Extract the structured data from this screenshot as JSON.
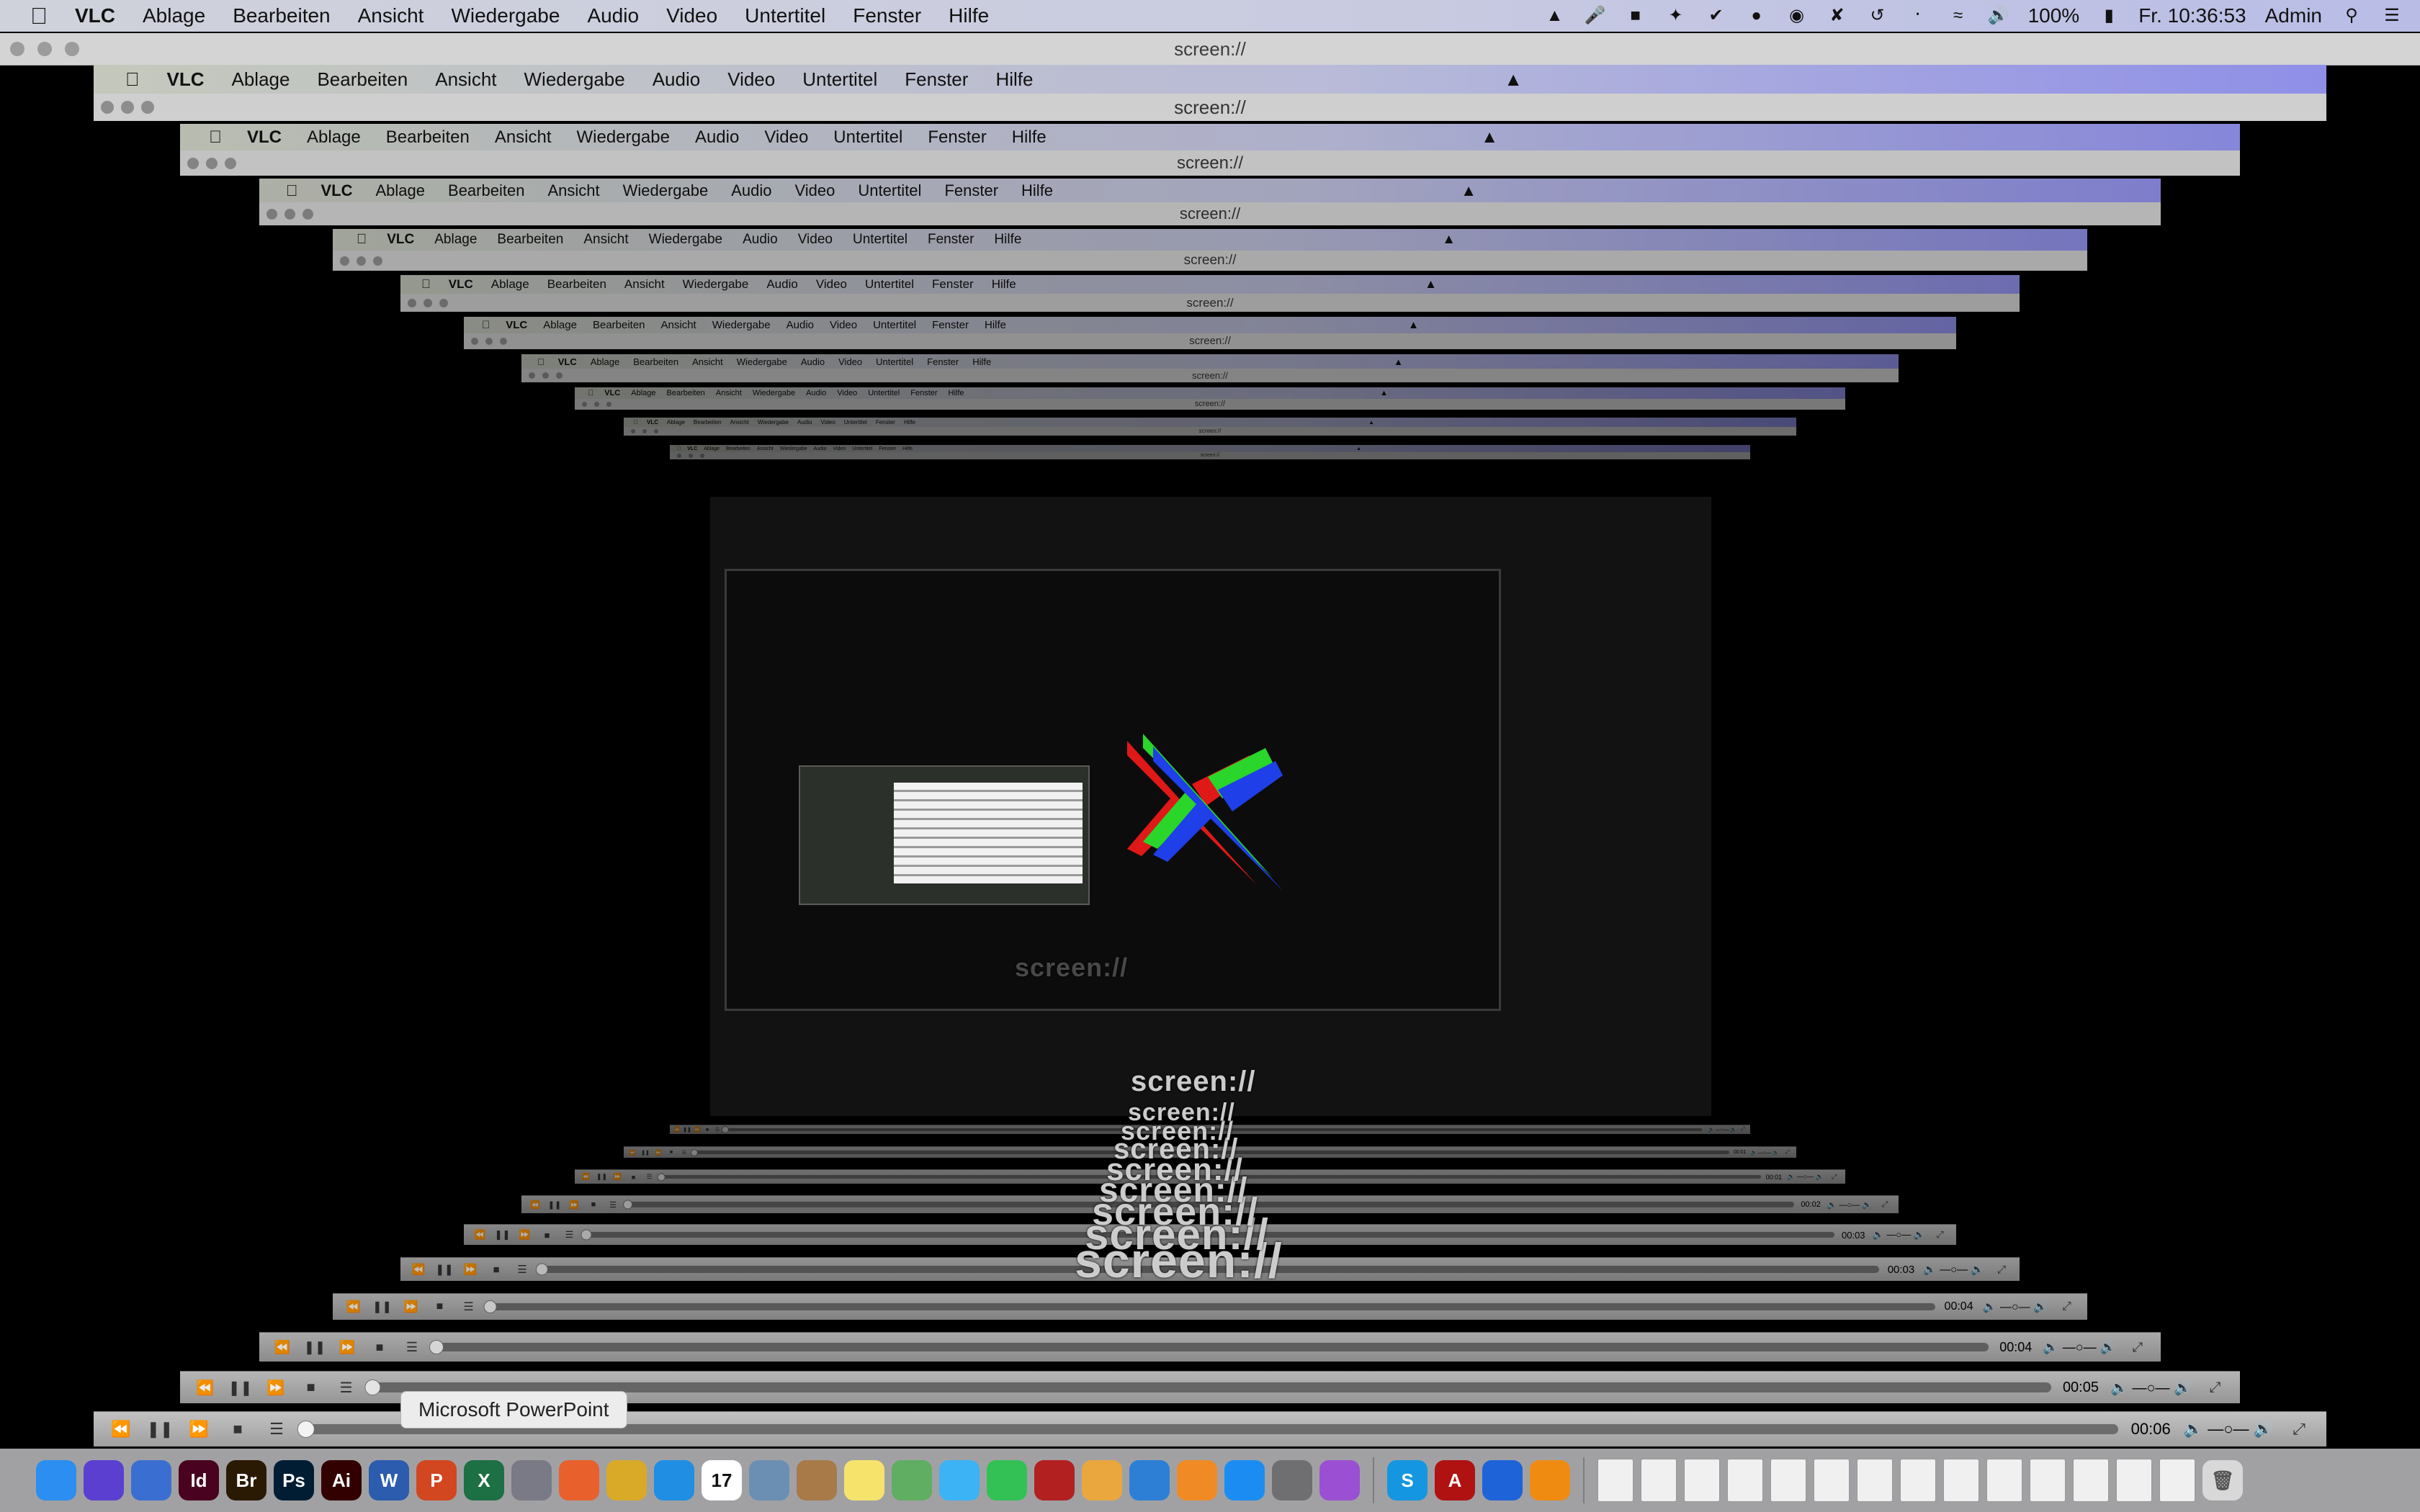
{
  "menubar": {
    "app": "VLC",
    "items": [
      "Ablage",
      "Bearbeiten",
      "Ansicht",
      "Wiedergabe",
      "Audio",
      "Video",
      "Untertitel",
      "Fenster",
      "Hilfe"
    ],
    "battery": "100%",
    "clock": "Fr. 10:36:53",
    "user": "Admin"
  },
  "window": {
    "title": "screen://"
  },
  "nested_times": [
    "00:06",
    "00:05",
    "00:04",
    "00:04",
    "00:03",
    "00:03",
    "00:02",
    "00:01",
    "00:01"
  ],
  "canvas_text": "screen://",
  "tooltip": "Microsoft PowerPoint",
  "dock_apps": [
    {
      "name": "finder-icon",
      "label": "",
      "color": "#2b8ef0"
    },
    {
      "name": "siri-icon",
      "label": "",
      "color": "#5b3fd0"
    },
    {
      "name": "safari-icon",
      "label": "",
      "color": "#3a6fd1"
    },
    {
      "name": "indesign-icon",
      "label": "Id",
      "color": "#49021f"
    },
    {
      "name": "bridge-icon",
      "label": "Br",
      "color": "#2a1a03"
    },
    {
      "name": "photoshop-icon",
      "label": "Ps",
      "color": "#001d34"
    },
    {
      "name": "illustrator-icon",
      "label": "Ai",
      "color": "#330000"
    },
    {
      "name": "word-icon",
      "label": "W",
      "color": "#2b5cad"
    },
    {
      "name": "powerpoint-icon",
      "label": "P",
      "color": "#d2471f"
    },
    {
      "name": "excel-icon",
      "label": "X",
      "color": "#1d7044"
    },
    {
      "name": "launchpad-icon",
      "label": "",
      "color": "#7a7a86"
    },
    {
      "name": "firefox-icon",
      "label": "",
      "color": "#e8602c"
    },
    {
      "name": "chrome-icon",
      "label": "",
      "color": "#d9a928"
    },
    {
      "name": "safari2-icon",
      "label": "",
      "color": "#1f8ee3"
    },
    {
      "name": "calendar-icon",
      "label": "17",
      "color": "#ffffff"
    },
    {
      "name": "preview-icon",
      "label": "",
      "color": "#6b8fb3"
    },
    {
      "name": "contacts-icon",
      "label": "",
      "color": "#a77a48"
    },
    {
      "name": "notes-icon",
      "label": "",
      "color": "#f6e36b"
    },
    {
      "name": "maps-icon",
      "label": "",
      "color": "#5fae62"
    },
    {
      "name": "messages-icon",
      "label": "",
      "color": "#3bb3f5"
    },
    {
      "name": "facetime-icon",
      "label": "",
      "color": "#33c156"
    },
    {
      "name": "photobooth-icon",
      "label": "",
      "color": "#b32020"
    },
    {
      "name": "photos-icon",
      "label": "",
      "color": "#e9a73d"
    },
    {
      "name": "keynote-icon",
      "label": "",
      "color": "#2d7fd6"
    },
    {
      "name": "books-icon",
      "label": "",
      "color": "#f08a24"
    },
    {
      "name": "appstore-icon",
      "label": "",
      "color": "#1b8df2"
    },
    {
      "name": "settings-icon",
      "label": "",
      "color": "#6f6f72"
    },
    {
      "name": "podcasts-icon",
      "label": "",
      "color": "#9b4fd3"
    },
    {
      "name": "skype-icon",
      "label": "S",
      "color": "#1496e0"
    },
    {
      "name": "acrobat-icon",
      "label": "A",
      "color": "#b01212"
    },
    {
      "name": "dropbox-icon",
      "label": "",
      "color": "#1e63d8"
    },
    {
      "name": "vlc-icon",
      "label": "",
      "color": "#f08b12"
    }
  ]
}
